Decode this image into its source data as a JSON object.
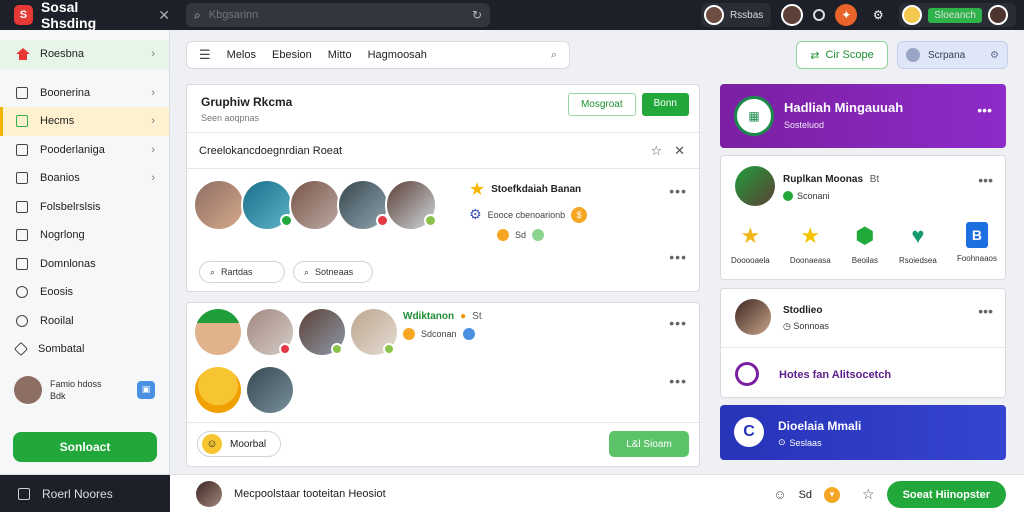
{
  "app": {
    "title": "Sosal Shsding",
    "logo_letter": "S"
  },
  "topbar": {
    "search_placeholder": "Kbgsarinn",
    "user1_name": "Rssbas",
    "user2_status": "Sloeanch"
  },
  "sidebar": {
    "items": [
      {
        "label": "Roesbna"
      },
      {
        "label": "Boonerina"
      },
      {
        "label": "Hecms"
      },
      {
        "label": "Pooderlaniga"
      },
      {
        "label": "Boanios"
      },
      {
        "label": "Folsbelrslsis"
      },
      {
        "label": "Nogrlong"
      },
      {
        "label": "Domnlonas"
      },
      {
        "label": "Eoosis"
      },
      {
        "label": "Rooilal"
      },
      {
        "label": "Sombatal"
      }
    ],
    "profile_name": "Famio hdoss",
    "profile_sub": "Bdk",
    "cta": "Sonloact"
  },
  "main_toolbar": {
    "tabs": [
      "Melos",
      "Ebesion",
      "Mitto",
      "Hagmoosah"
    ]
  },
  "actions": {
    "green_btn": "Cir Scope",
    "chip_label": "Scrpana"
  },
  "card1": {
    "title": "Gruphiw Rkcma",
    "subtitle": "Seen aoqpnas",
    "btn_secondary": "Mosgroat",
    "btn_primary": "Bonn",
    "row_label": "Creelokancdoegnrdian Roeat",
    "person_name": "Stoefkdaiah Banan",
    "person_desc": "Eooce cbenoarionb",
    "person_stat": "Sd",
    "input1": "Rartdas",
    "input2": "Sotneaas"
  },
  "card2": {
    "person_name": "Wdiktanon",
    "person_tag": "St",
    "person_desc": "Sdconan",
    "chip": "Moorbal",
    "send": "L&l Sioam"
  },
  "right": {
    "promo1_title": "Hadliah Mingauuah",
    "promo1_sub": "Sosteluod",
    "card1_name": "Ruplkan Moonas",
    "card1_tag": "Bt",
    "card1_sub": "Sconani",
    "icons": [
      {
        "label": "Dooooaela",
        "glyph": "★",
        "color": "#f2b71a"
      },
      {
        "label": "Doonaeasa",
        "glyph": "★",
        "color": "#f5c400"
      },
      {
        "label": "Beoilas",
        "glyph": "⬢",
        "color": "#1faa3a"
      },
      {
        "label": "Rsoiedsea",
        "glyph": "♥",
        "color": "#179a6e"
      },
      {
        "label": "Foohnaaos",
        "glyph": "B",
        "color": "#1c6fe0"
      }
    ],
    "card2_name": "Stodlieo",
    "card2_sub": "Sonnoas",
    "link": "Hotes fan Alitsocetch",
    "promo2_title": "Dioelaia Mmali",
    "promo2_sub": "Seslaas"
  },
  "bottombar": {
    "left_label": "Roerl Noores",
    "compose": "Mecpoolstaar tooteitan Heosiot",
    "count": "Sd",
    "post": "Soeat Hiinopster"
  }
}
